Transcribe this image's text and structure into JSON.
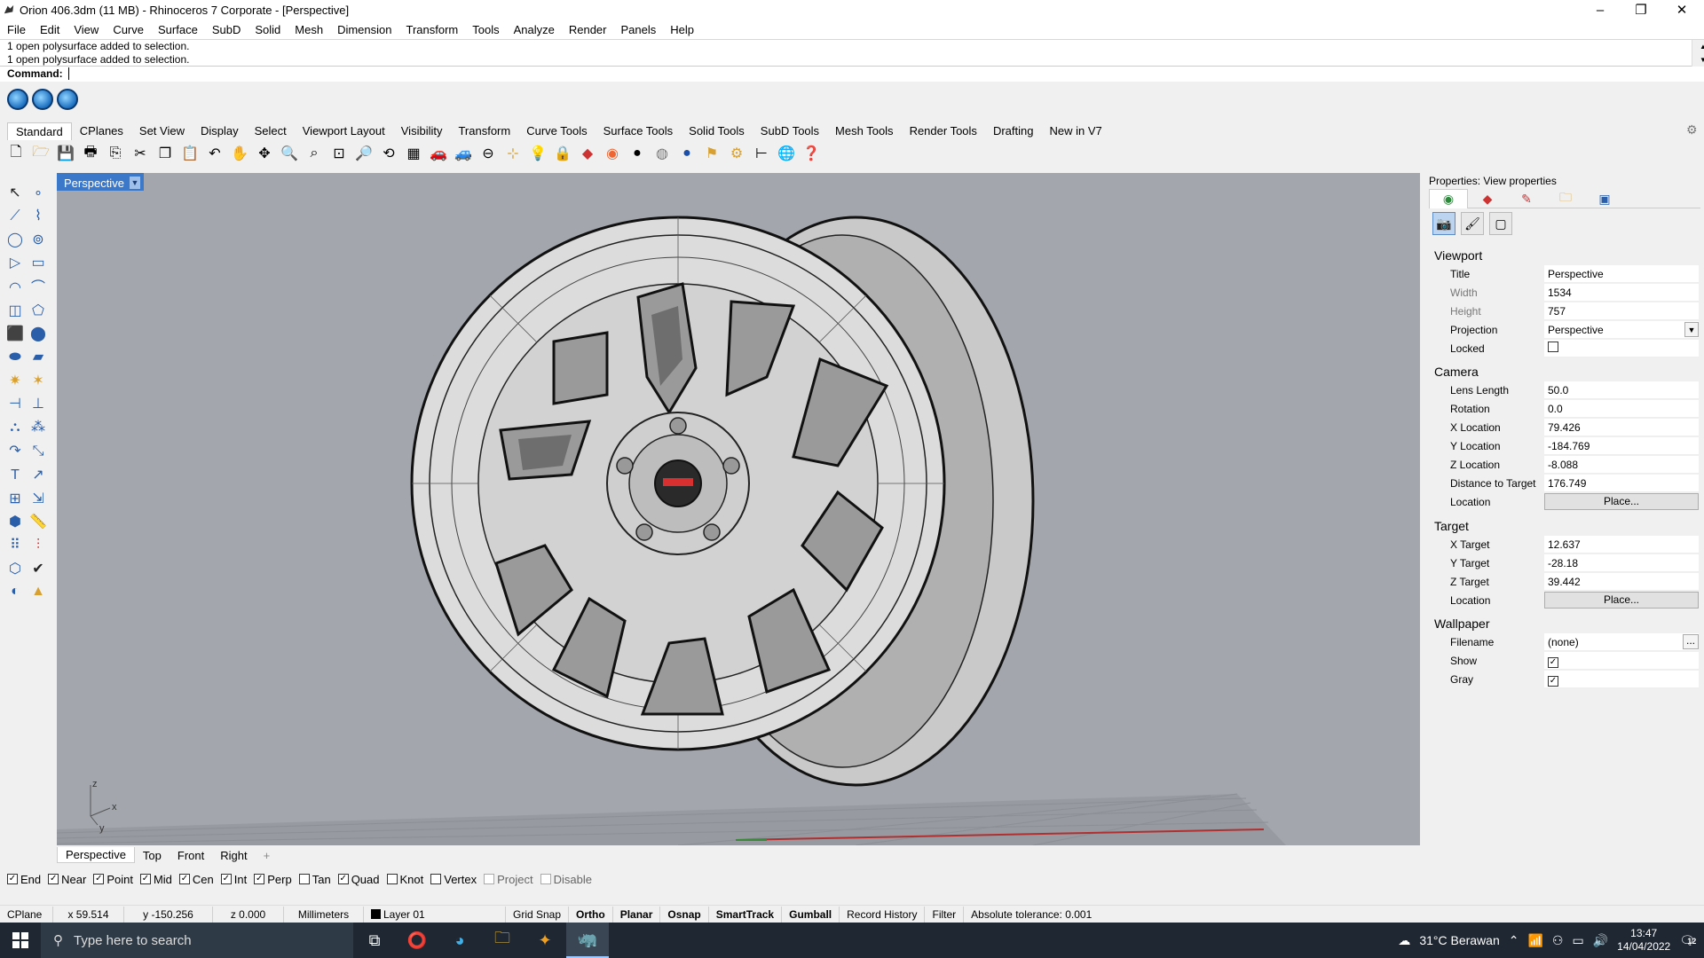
{
  "window": {
    "title": "Orion 406.3dm (11 MB) - Rhinoceros 7 Corporate - [Perspective]"
  },
  "menu": [
    "File",
    "Edit",
    "View",
    "Curve",
    "Surface",
    "SubD",
    "Solid",
    "Mesh",
    "Dimension",
    "Transform",
    "Tools",
    "Analyze",
    "Render",
    "Panels",
    "Help"
  ],
  "command": {
    "history": [
      "1 open polysurface added to selection.",
      "1 open polysurface added to selection."
    ],
    "prompt": "Command:"
  },
  "toolbar_tabs": [
    "Standard",
    "CPlanes",
    "Set View",
    "Display",
    "Select",
    "Viewport Layout",
    "Visibility",
    "Transform",
    "Curve Tools",
    "Surface Tools",
    "Solid Tools",
    "SubD Tools",
    "Mesh Tools",
    "Render Tools",
    "Drafting",
    "New in V7"
  ],
  "viewport": {
    "title": "Perspective",
    "axis_z": "z",
    "axis_x": "x",
    "axis_y": "y"
  },
  "view_tabs": [
    "Perspective",
    "Top",
    "Front",
    "Right",
    "+"
  ],
  "osnaps": [
    {
      "label": "End",
      "checked": true
    },
    {
      "label": "Near",
      "checked": true
    },
    {
      "label": "Point",
      "checked": true
    },
    {
      "label": "Mid",
      "checked": true
    },
    {
      "label": "Cen",
      "checked": true
    },
    {
      "label": "Int",
      "checked": true
    },
    {
      "label": "Perp",
      "checked": true
    },
    {
      "label": "Tan",
      "checked": false
    },
    {
      "label": "Quad",
      "checked": true
    },
    {
      "label": "Knot",
      "checked": false
    },
    {
      "label": "Vertex",
      "checked": false
    },
    {
      "label": "Project",
      "checked": false
    },
    {
      "label": "Disable",
      "checked": false
    }
  ],
  "status": {
    "cplane": "CPlane",
    "x": "x 59.514",
    "y": "y -150.256",
    "z": "z 0.000",
    "units": "Millimeters",
    "layer": "Layer 01",
    "grid_snap": "Grid Snap",
    "ortho": "Ortho",
    "planar": "Planar",
    "osnap": "Osnap",
    "smarttrack": "SmartTrack",
    "gumball": "Gumball",
    "record_history": "Record History",
    "filter": "Filter",
    "tolerance": "Absolute tolerance: 0.001"
  },
  "properties": {
    "panel_title": "Properties: View properties",
    "viewport_section": "Viewport",
    "camera_section": "Camera",
    "target_section": "Target",
    "wallpaper_section": "Wallpaper",
    "rows": {
      "title": {
        "label": "Title",
        "value": "Perspective"
      },
      "width": {
        "label": "Width",
        "value": "1534"
      },
      "height": {
        "label": "Height",
        "value": "757"
      },
      "projection": {
        "label": "Projection",
        "value": "Perspective"
      },
      "locked": {
        "label": "Locked",
        "checked": false
      },
      "lens_length": {
        "label": "Lens Length",
        "value": "50.0"
      },
      "rotation": {
        "label": "Rotation",
        "value": "0.0"
      },
      "x_location": {
        "label": "X Location",
        "value": "79.426"
      },
      "y_location": {
        "label": "Y Location",
        "value": "-184.769"
      },
      "z_location": {
        "label": "Z Location",
        "value": "-8.088"
      },
      "distance": {
        "label": "Distance to Target",
        "value": "176.749"
      },
      "cam_location": {
        "label": "Location",
        "button": "Place..."
      },
      "x_target": {
        "label": "X Target",
        "value": "12.637"
      },
      "y_target": {
        "label": "Y Target",
        "value": "-28.18"
      },
      "z_target": {
        "label": "Z Target",
        "value": "39.442"
      },
      "tgt_location": {
        "label": "Location",
        "button": "Place..."
      },
      "filename": {
        "label": "Filename",
        "value": "(none)",
        "button": "..."
      },
      "show": {
        "label": "Show",
        "checked": true
      },
      "gray": {
        "label": "Gray",
        "checked": true
      }
    }
  },
  "taskbar": {
    "search_placeholder": "Type here to search",
    "weather": "31°C  Berawan",
    "time": "13:47",
    "date": "14/04/2022",
    "notifications": "12"
  },
  "colors": {
    "viewport_bg": "#a3a7ad",
    "vp_title": "#3b78c9",
    "taskbar": "#1f2732"
  }
}
